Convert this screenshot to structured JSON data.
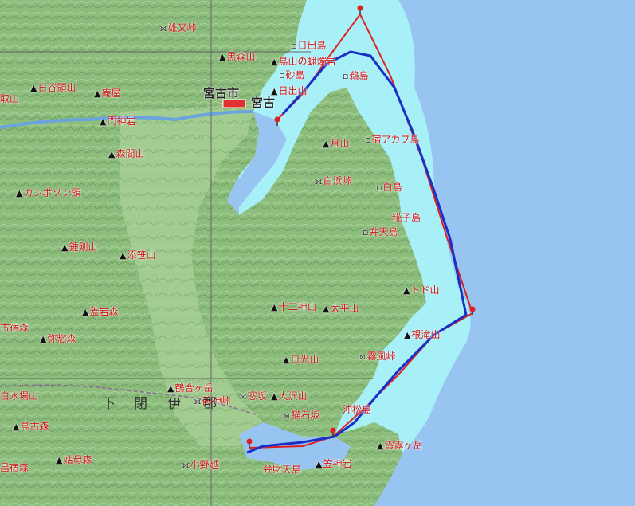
{
  "colors": {
    "sea": "#98c4f2",
    "shallow": "#a8f0f8",
    "land": "#8fbf7e",
    "route_red": "#e02020",
    "route_blue": "#1a2ec8"
  },
  "peaks": {
    "kuromori": "黒森山",
    "tamatani": "日谷頭山",
    "tadora": "庵屋",
    "monjin": "門神岩",
    "morisyo": "森間山",
    "kanpon": "カンポゾン頭",
    "tsurugi": "鍾剣山",
    "sasahara": "添笹山",
    "sanzu": "蓋岩森",
    "mida": "弥惣森",
    "tsukiyama": "月山",
    "hiyama": "日出山",
    "jyunishin": "十二神山",
    "taihei": "太平山",
    "nedaki": "根滝山",
    "mochiyama": "日光山",
    "oosawa": "大沢山",
    "matsuishi": "猫石坂",
    "okiyama": "姑母森",
    "kitaoku": "鳥古森",
    "sakasama": "白水場山",
    "kogoshi": "昌宿森",
    "sendai": "鶴合ヶ岳",
    "hinoki": "霞露ヶ岳",
    "kasa": "笠神岩",
    "tokoyama": "トド山"
  },
  "passes": {
    "oyasu": "雄又峠",
    "shirahama": "白浜峠",
    "kirisuso": "霧風峠",
    "madohara": "窓坂",
    "onosato": "小野越",
    "fukuyama": "鶴神峠"
  },
  "islands": {
    "hide": "日出島",
    "tori": "鳥山の蝋燭岩",
    "suna": "砂島",
    "kura": "鵜島",
    "yadoakabu": "宿アカブ島",
    "shima": "白島",
    "kouji": "糀子島",
    "benten": "弁天島",
    "okimatsu": "沖松島",
    "benten2": "弁財天島"
  },
  "cities": {
    "miyako": "宮古市",
    "miyako_st": "宮古"
  },
  "district": [
    "下",
    "閉",
    "伊",
    "郡"
  ],
  "top_left": "取山",
  "left_mid": "古宿森"
}
